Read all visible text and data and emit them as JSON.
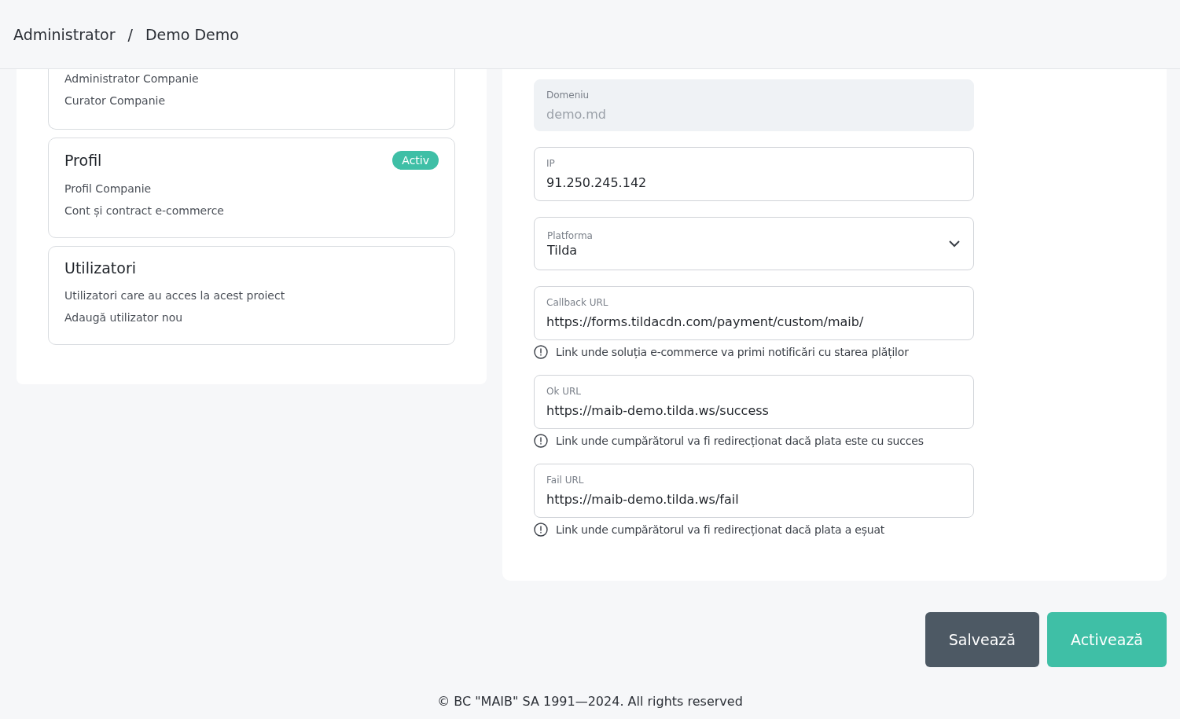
{
  "breadcrumb": [
    "Administrator",
    "Demo Demo"
  ],
  "breadcrumb_separator": "/",
  "sections": [
    {
      "items": [
        "Administrator Companie",
        "Curator Companie"
      ]
    },
    {
      "title": "Profil",
      "badge": "Activ",
      "items": [
        "Profil Companie",
        "Cont și contract e-commerce"
      ]
    },
    {
      "title": "Utilizatori",
      "items": [
        "Utilizatori care au acces la acest proiect",
        "Adaugă utilizator nou"
      ]
    }
  ],
  "fields": [
    {
      "kind": "input",
      "label": "Domeniu",
      "value": "demo.md",
      "disabled": true
    },
    {
      "kind": "input",
      "label": "IP",
      "value": "91.250.245.142",
      "disabled": false
    },
    {
      "kind": "select",
      "label": "Platforma",
      "value": "Tilda",
      "disabled": false
    },
    {
      "kind": "input",
      "label": "Callback URL",
      "value": "https://forms.tildacdn.com/payment/custom/maib/",
      "disabled": false,
      "hint": "Link unde soluția e-commerce va primi notificări cu starea plăților"
    },
    {
      "kind": "input",
      "label": "Ok URL",
      "value": "https://maib-demo.tilda.ws/success",
      "disabled": false,
      "hint": "Link unde cumpărătorul va fi redirecționat dacă plata este cu succes"
    },
    {
      "kind": "input",
      "label": "Fail URL",
      "value": "https://maib-demo.tilda.ws/fail",
      "disabled": false,
      "hint": "Link unde cumpărătorul va fi redirecționat dacă plata a eșuat"
    }
  ],
  "buttons": [
    {
      "kind": "secondary",
      "label": "Salvează"
    },
    {
      "kind": "primary",
      "label": "Activează"
    }
  ],
  "footer": "© BC \"MAIB\" SA 1991—2024. All rights reserved"
}
